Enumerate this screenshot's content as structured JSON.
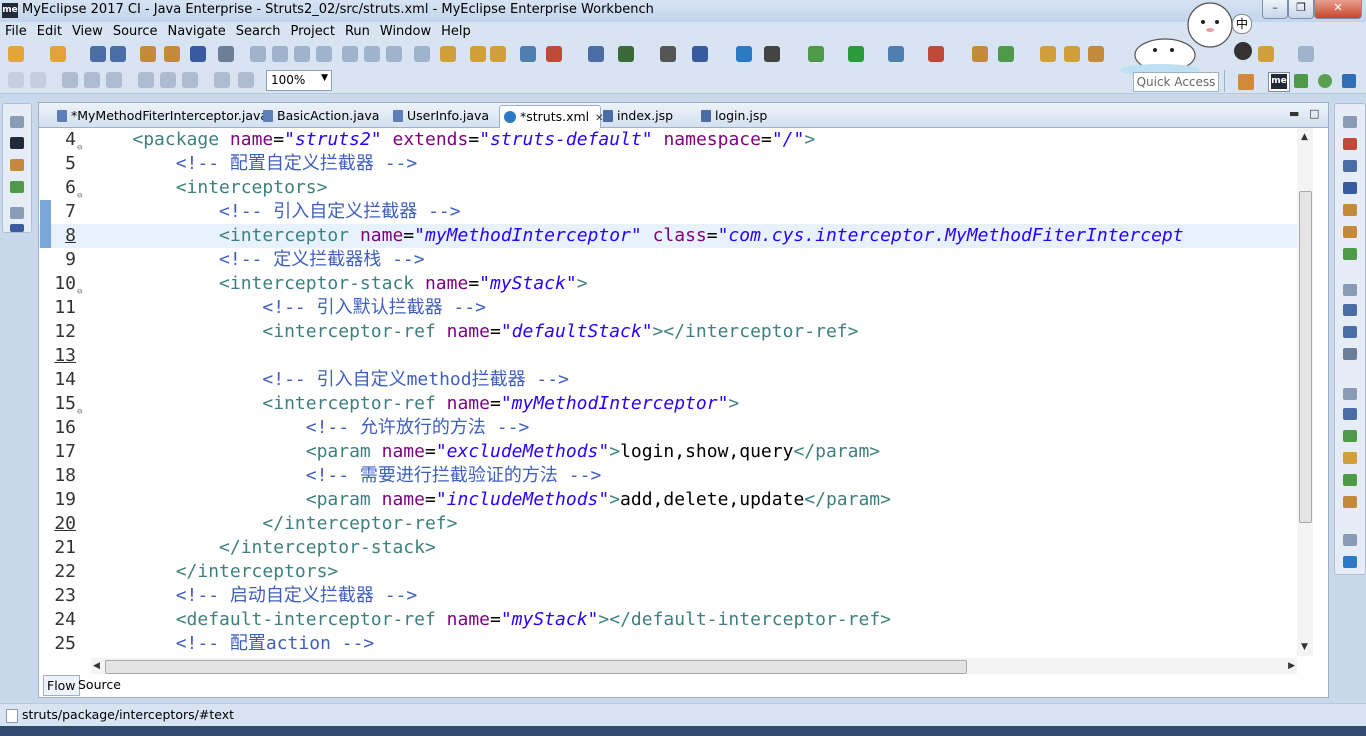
{
  "window": {
    "title": "MyEclipse 2017 CI - Java Enterprise - Struts2_02/src/struts.xml - MyEclipse Enterprise Workbench",
    "app_icon_label": "me",
    "ime_indicator": "中"
  },
  "menu": [
    "File",
    "Edit",
    "View",
    "Source",
    "Navigate",
    "Search",
    "Project",
    "Run",
    "Window",
    "Help"
  ],
  "toolbar": {
    "zoom_value": "100%",
    "quick_access": "Quick Access",
    "perspective_label": "me"
  },
  "editor": {
    "tabs": [
      {
        "label": "*MyMethodFiterInterceptor.java",
        "icon": "java-file-icon",
        "active": false
      },
      {
        "label": "BasicAction.java",
        "icon": "java-file-icon",
        "active": false
      },
      {
        "label": "UserInfo.java",
        "icon": "java-file-icon",
        "active": false
      },
      {
        "label": "*struts.xml",
        "icon": "xml-file-icon",
        "active": true
      },
      {
        "label": "index.jsp",
        "icon": "jsp-file-icon",
        "active": false
      },
      {
        "label": "login.jsp",
        "icon": "jsp-file-icon",
        "active": false
      }
    ],
    "current_line": 8,
    "lines": [
      {
        "n": "4",
        "fold": true,
        "indent": "    ",
        "tokens": [
          [
            "tag",
            "<package "
          ],
          [
            "attr",
            "name"
          ],
          [
            "txt",
            "="
          ],
          [
            "val",
            "\"struts2\""
          ],
          [
            "txt",
            " "
          ],
          [
            "attr",
            "extends"
          ],
          [
            "txt",
            "="
          ],
          [
            "val",
            "\"struts-default\""
          ],
          [
            "txt",
            " "
          ],
          [
            "attr",
            "namespace"
          ],
          [
            "txt",
            "="
          ],
          [
            "val",
            "\"/\""
          ],
          [
            "tag",
            ">"
          ]
        ]
      },
      {
        "n": "5",
        "indent": "        ",
        "tokens": [
          [
            "cmt",
            "<!-- 配置自定义拦截器 -->"
          ]
        ]
      },
      {
        "n": "6",
        "fold": true,
        "indent": "        ",
        "tokens": [
          [
            "tag",
            "<interceptors>"
          ]
        ]
      },
      {
        "n": "7",
        "indent": "            ",
        "tokens": [
          [
            "cmt",
            "<!-- 引入自定义拦截器 -->"
          ]
        ]
      },
      {
        "n": "8",
        "mark": true,
        "indent": "            ",
        "tokens": [
          [
            "tag",
            "<interceptor "
          ],
          [
            "attr",
            "name"
          ],
          [
            "txt",
            "="
          ],
          [
            "val",
            "\"myMethodInterceptor\""
          ],
          [
            "txt",
            " "
          ],
          [
            "attr",
            "class"
          ],
          [
            "txt",
            "="
          ],
          [
            "val",
            "\"com.cys.interceptor.MyMethodFiterIntercept"
          ]
        ]
      },
      {
        "n": "9",
        "indent": "            ",
        "tokens": [
          [
            "cmt",
            "<!-- 定义拦截器栈 -->"
          ]
        ]
      },
      {
        "n": "10",
        "fold": true,
        "indent": "            ",
        "tokens": [
          [
            "tag",
            "<interceptor-stack "
          ],
          [
            "attr",
            "name"
          ],
          [
            "txt",
            "="
          ],
          [
            "val",
            "\"myStack\""
          ],
          [
            "tag",
            ">"
          ]
        ]
      },
      {
        "n": "11",
        "indent": "                ",
        "tokens": [
          [
            "cmt",
            "<!-- 引入默认拦截器 -->"
          ]
        ]
      },
      {
        "n": "12",
        "indent": "                ",
        "tokens": [
          [
            "tag",
            "<interceptor-ref "
          ],
          [
            "attr",
            "name"
          ],
          [
            "txt",
            "="
          ],
          [
            "val",
            "\"defaultStack\""
          ],
          [
            "tag",
            "></interceptor-ref>"
          ]
        ]
      },
      {
        "n": "13",
        "mark": true,
        "indent": "",
        "tokens": []
      },
      {
        "n": "14",
        "indent": "                ",
        "tokens": [
          [
            "cmt",
            "<!-- 引入自定义method拦截器 -->"
          ]
        ]
      },
      {
        "n": "15",
        "fold": true,
        "indent": "                ",
        "tokens": [
          [
            "tag",
            "<interceptor-ref "
          ],
          [
            "attr",
            "name"
          ],
          [
            "txt",
            "="
          ],
          [
            "val",
            "\"myMethodInterceptor\""
          ],
          [
            "tag",
            ">"
          ]
        ]
      },
      {
        "n": "16",
        "indent": "                    ",
        "tokens": [
          [
            "cmt",
            "<!-- 允许放行的方法 -->"
          ]
        ]
      },
      {
        "n": "17",
        "indent": "                    ",
        "tokens": [
          [
            "tag",
            "<param "
          ],
          [
            "attr",
            "name"
          ],
          [
            "txt",
            "="
          ],
          [
            "val",
            "\"excludeMethods\""
          ],
          [
            "tag",
            ">"
          ],
          [
            "txt",
            "login,show,query"
          ],
          [
            "tag",
            "</param>"
          ]
        ]
      },
      {
        "n": "18",
        "indent": "                    ",
        "tokens": [
          [
            "cmt",
            "<!-- 需要进行拦截验证的方法 -->"
          ]
        ]
      },
      {
        "n": "19",
        "indent": "                    ",
        "tokens": [
          [
            "tag",
            "<param "
          ],
          [
            "attr",
            "name"
          ],
          [
            "txt",
            "="
          ],
          [
            "val",
            "\"includeMethods\""
          ],
          [
            "tag",
            ">"
          ],
          [
            "txt",
            "add,delete,update"
          ],
          [
            "tag",
            "</param>"
          ]
        ]
      },
      {
        "n": "20",
        "mark": true,
        "indent": "                ",
        "tokens": [
          [
            "tag",
            "</interceptor-ref>"
          ]
        ]
      },
      {
        "n": "21",
        "indent": "            ",
        "tokens": [
          [
            "tag",
            "</interceptor-stack>"
          ]
        ]
      },
      {
        "n": "22",
        "indent": "        ",
        "tokens": [
          [
            "tag",
            "</interceptors>"
          ]
        ]
      },
      {
        "n": "23",
        "indent": "        ",
        "tokens": [
          [
            "cmt",
            "<!-- 启动自定义拦截器 -->"
          ]
        ]
      },
      {
        "n": "24",
        "indent": "        ",
        "tokens": [
          [
            "tag",
            "<default-interceptor-ref "
          ],
          [
            "attr",
            "name"
          ],
          [
            "txt",
            "="
          ],
          [
            "val",
            "\"myStack\""
          ],
          [
            "tag",
            "></default-interceptor-ref>"
          ]
        ]
      },
      {
        "n": "25",
        "indent": "        ",
        "tokens": [
          [
            "cmt",
            "<!-- 配置action -->"
          ]
        ]
      }
    ],
    "bottom_tabs": [
      {
        "label": "Flow",
        "active": true
      },
      {
        "label": "Source",
        "active": false
      }
    ]
  },
  "status": {
    "path": "struts/package/interceptors/#text"
  },
  "colors": {
    "xml_tag": "#3f7f7f",
    "xml_attr": "#7f007f",
    "xml_value": "#2a00ff",
    "xml_comment": "#3f5fbf",
    "current_line_bg": "#e8f2fe"
  }
}
